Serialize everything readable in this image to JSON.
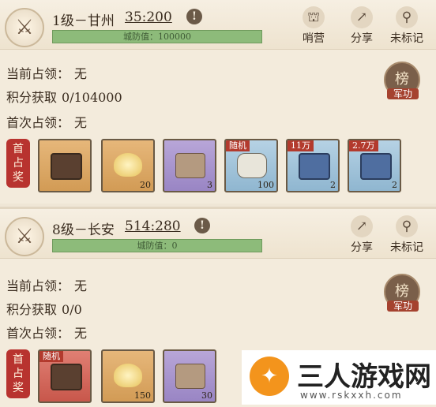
{
  "card1": {
    "title": "1级－甘州",
    "coordinates": "35:200",
    "locate_icon": "!",
    "defense_label": "城防值：100000",
    "buttons": [
      {
        "label": "哨营",
        "icon": "sentry-tower-icon",
        "glyph": "⛫"
      },
      {
        "label": "分享",
        "icon": "share-icon",
        "glyph": "↗"
      },
      {
        "label": "未标记",
        "icon": "map-pin-icon",
        "glyph": "⚲"
      }
    ],
    "occupant_label": "当前占领：",
    "occupant_value": "无",
    "points_label": "积分获取",
    "points_value": "0/104000",
    "first_label": "首次占领：",
    "first_value": "无",
    "rank_glyph": "榜",
    "rank_sub": "军功",
    "first_reward_tag": "首占奖",
    "rewards": [
      {
        "tag": "",
        "qty": "",
        "color": "orange",
        "art": "chest"
      },
      {
        "tag": "",
        "qty": "20",
        "color": "orange",
        "art": "ingot"
      },
      {
        "tag": "",
        "qty": "3",
        "color": "purple",
        "art": "books"
      },
      {
        "tag": "随机",
        "qty": "100",
        "color": "blue",
        "art": "scroll"
      },
      {
        "tag": "11万",
        "qty": "2",
        "color": "blue",
        "art": "bluebox"
      },
      {
        "tag": "2.7万",
        "qty": "2",
        "color": "blue",
        "art": "bluebox"
      }
    ]
  },
  "card2": {
    "title": "8级－长安",
    "coordinates": "514:280",
    "locate_icon": "!",
    "defense_label": "城防值：0",
    "buttons": [
      {
        "label": "分享",
        "icon": "share-icon",
        "glyph": "↗"
      },
      {
        "label": "未标记",
        "icon": "map-pin-icon",
        "glyph": "⚲"
      }
    ],
    "occupant_label": "当前占领：",
    "occupant_value": "无",
    "points_label": "积分获取",
    "points_value": "0/0",
    "first_label": "首次占领：",
    "first_value": "无",
    "rank_glyph": "榜",
    "rank_sub": "军功",
    "first_reward_tag": "首占奖",
    "rewards": [
      {
        "tag": "随机",
        "qty": "",
        "color": "red",
        "art": "chest"
      },
      {
        "tag": "",
        "qty": "150",
        "color": "orange",
        "art": "ingot"
      },
      {
        "tag": "",
        "qty": "30",
        "color": "purple",
        "art": "books"
      }
    ]
  },
  "card1_first_reward_tag_top": "",
  "watermark": {
    "logo_glyph": "✦",
    "title": "三人游戏网",
    "url": "www.rskxxh.com"
  },
  "colors": {
    "background": "#f3ebdc",
    "defense_bar": "#8dbb7a",
    "reward_tag_red": "#b8332f",
    "rank_badge": "#7a5f4a"
  }
}
